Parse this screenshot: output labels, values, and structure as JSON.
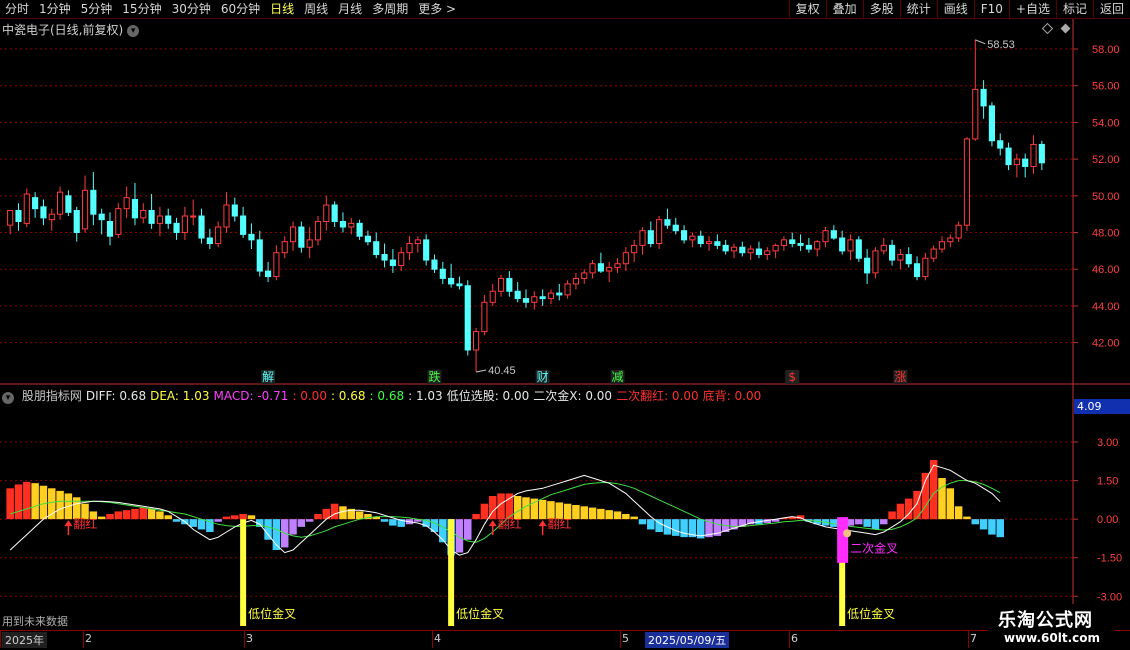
{
  "toolbar": {
    "periods": [
      "分时",
      "1分钟",
      "5分钟",
      "15分钟",
      "30分钟",
      "60分钟",
      "日线",
      "周线",
      "月线",
      "多周期",
      "更多 >"
    ],
    "active_period": "日线",
    "actions": [
      "复权",
      "叠加",
      "多股",
      "统计",
      "画线",
      "F10",
      "+自选",
      "标记",
      "返回"
    ]
  },
  "stock": {
    "title": "中瓷电子(日线,前复权)",
    "chevron": "chevron-down-icon"
  },
  "indicator_header": [
    {
      "text": "股朋指标网",
      "color": "#c8c8c8"
    },
    {
      "text": "DIFF: 0.68",
      "color": "#e8e8e8"
    },
    {
      "text": "DEA: 1.03",
      "color": "#ffff40"
    },
    {
      "text": "MACD: -0.71",
      "color": "#ff40ff"
    },
    {
      "text": ": 0.00",
      "color": "#ff3030"
    },
    {
      "text": ": 0.68",
      "color": "#ffff40"
    },
    {
      "text": ": 0.68",
      "color": "#40ff40"
    },
    {
      "text": ": 1.03",
      "color": "#e8e8e8"
    },
    {
      "text": "低位选股: 0.00",
      "color": "#e8e8e8"
    },
    {
      "text": "二次金X: 0.00",
      "color": "#e8e8e8"
    },
    {
      "text": "二次翻红: 0.00",
      "color": "#ff3030"
    },
    {
      "text": "底背: 0.00",
      "color": "#ff3030"
    }
  ],
  "right_readout": "4.09",
  "future_note": "用到未来数据",
  "dates": [
    "2025年",
    "2",
    "3",
    "4",
    "5",
    "6",
    "7"
  ],
  "selected_date": "2025/05/09/五",
  "watermark": {
    "name": "乐淘公式网",
    "url": "www.60lt.com"
  },
  "colors": {
    "up": "#ff3c3c",
    "down": "#54ffff",
    "grid": "#8b0000",
    "axis": "#c03030",
    "yellow": "#ffff40",
    "magenta": "#ff2dff"
  },
  "chart_data": [
    {
      "type": "candlestick",
      "title": "中瓷电子(日线,前复权)",
      "y_ticks": [
        42.0,
        44.0,
        46.0,
        48.0,
        50.0,
        52.0,
        54.0,
        56.0,
        58.0
      ],
      "ylim": [
        40.4,
        58.6
      ],
      "max_label": "58.53",
      "min_label": "40.45",
      "ohlc": [
        [
          48.4,
          48.9,
          47.9,
          49.2
        ],
        [
          49.2,
          49.6,
          48.1,
          48.6
        ],
        [
          48.5,
          50.4,
          48.3,
          50.1
        ],
        [
          49.9,
          50.2,
          48.8,
          49.3
        ],
        [
          49.4,
          49.8,
          48.4,
          48.8
        ],
        [
          48.7,
          49.3,
          48.1,
          49.0
        ],
        [
          49.0,
          50.5,
          48.7,
          50.2
        ],
        [
          50.0,
          50.3,
          48.9,
          49.1
        ],
        [
          49.2,
          49.4,
          47.5,
          48.0
        ],
        [
          48.2,
          51.1,
          48.0,
          50.3
        ],
        [
          50.3,
          51.3,
          48.4,
          49.0
        ],
        [
          49.0,
          49.3,
          47.9,
          48.7
        ],
        [
          48.6,
          49.1,
          47.3,
          47.8
        ],
        [
          47.9,
          49.6,
          47.7,
          49.3
        ],
        [
          49.3,
          50.5,
          48.8,
          49.9
        ],
        [
          49.8,
          50.7,
          48.4,
          48.8
        ],
        [
          48.8,
          49.6,
          48.5,
          49.2
        ],
        [
          49.2,
          50.1,
          48.2,
          48.5
        ],
        [
          48.5,
          49.4,
          47.8,
          48.9
        ],
        [
          48.9,
          49.3,
          48.2,
          48.5
        ],
        [
          48.5,
          48.8,
          47.6,
          48.0
        ],
        [
          48.0,
          49.4,
          47.6,
          48.9
        ],
        [
          48.9,
          49.8,
          48.4,
          48.9
        ],
        [
          48.9,
          49.3,
          47.4,
          47.7
        ],
        [
          47.7,
          48.2,
          47.1,
          47.4
        ],
        [
          47.4,
          48.6,
          47.2,
          48.3
        ],
        [
          48.3,
          50.2,
          48.0,
          49.5
        ],
        [
          49.5,
          49.9,
          48.6,
          48.9
        ],
        [
          48.9,
          49.4,
          47.7,
          47.9
        ],
        [
          47.9,
          48.5,
          47.1,
          47.6
        ],
        [
          47.6,
          48.1,
          45.6,
          45.9
        ],
        [
          45.9,
          46.4,
          45.3,
          45.6
        ],
        [
          45.6,
          47.3,
          45.4,
          46.9
        ],
        [
          46.9,
          47.8,
          46.6,
          47.5
        ],
        [
          47.5,
          48.6,
          47.0,
          48.3
        ],
        [
          48.3,
          48.6,
          46.9,
          47.2
        ],
        [
          47.2,
          48.3,
          46.6,
          47.6
        ],
        [
          47.6,
          48.9,
          47.3,
          48.6
        ],
        [
          48.6,
          50.0,
          48.1,
          49.5
        ],
        [
          49.5,
          49.7,
          48.3,
          48.6
        ],
        [
          48.6,
          49.1,
          48.0,
          48.3
        ],
        [
          48.3,
          48.8,
          47.9,
          48.5
        ],
        [
          48.5,
          48.7,
          47.6,
          47.8
        ],
        [
          47.8,
          48.1,
          47.3,
          47.5
        ],
        [
          47.5,
          48.0,
          46.6,
          46.8
        ],
        [
          46.8,
          47.4,
          46.1,
          46.5
        ],
        [
          46.5,
          47.1,
          45.8,
          46.2
        ],
        [
          46.2,
          47.2,
          45.9,
          46.9
        ],
        [
          46.9,
          47.8,
          46.5,
          47.4
        ],
        [
          47.4,
          47.8,
          46.9,
          47.6
        ],
        [
          47.6,
          47.9,
          46.2,
          46.5
        ],
        [
          46.5,
          46.8,
          45.8,
          46.0
        ],
        [
          46.0,
          46.4,
          45.2,
          45.5
        ],
        [
          45.5,
          46.3,
          45.0,
          45.2
        ],
        [
          45.2,
          45.6,
          44.9,
          45.1
        ],
        [
          45.1,
          45.4,
          41.3,
          41.6
        ],
        [
          41.6,
          42.8,
          40.4,
          42.6
        ],
        [
          42.6,
          44.6,
          42.4,
          44.2
        ],
        [
          44.2,
          45.2,
          44.0,
          44.8
        ],
        [
          44.8,
          45.7,
          44.5,
          45.5
        ],
        [
          45.5,
          45.9,
          44.5,
          44.8
        ],
        [
          44.8,
          45.3,
          44.2,
          44.4
        ],
        [
          44.4,
          44.9,
          43.9,
          44.2
        ],
        [
          44.2,
          44.8,
          43.8,
          44.5
        ],
        [
          44.5,
          44.9,
          44.0,
          44.4
        ],
        [
          44.4,
          44.9,
          44.1,
          44.7
        ],
        [
          44.7,
          45.2,
          44.3,
          44.6
        ],
        [
          44.6,
          45.4,
          44.4,
          45.2
        ],
        [
          45.2,
          45.8,
          44.9,
          45.5
        ],
        [
          45.5,
          46.0,
          45.2,
          45.8
        ],
        [
          45.8,
          46.5,
          45.5,
          46.3
        ],
        [
          46.3,
          46.9,
          45.8,
          45.9
        ],
        [
          45.9,
          46.4,
          45.3,
          46.1
        ],
        [
          46.1,
          46.6,
          45.8,
          46.3
        ],
        [
          46.3,
          47.2,
          45.9,
          46.9
        ],
        [
          46.9,
          47.6,
          46.4,
          47.3
        ],
        [
          47.3,
          48.3,
          46.8,
          48.1
        ],
        [
          48.1,
          48.6,
          47.2,
          47.4
        ],
        [
          47.4,
          48.9,
          47.1,
          48.7
        ],
        [
          48.7,
          49.3,
          48.2,
          48.4
        ],
        [
          48.4,
          48.8,
          47.9,
          48.1
        ],
        [
          48.1,
          48.4,
          47.4,
          47.6
        ],
        [
          47.6,
          48.0,
          47.2,
          47.8
        ],
        [
          47.8,
          48.1,
          47.2,
          47.4
        ],
        [
          47.4,
          47.8,
          47.0,
          47.5
        ],
        [
          47.5,
          47.9,
          47.1,
          47.3
        ],
        [
          47.3,
          47.6,
          46.8,
          47.0
        ],
        [
          47.0,
          47.4,
          46.6,
          47.2
        ],
        [
          47.2,
          47.5,
          46.7,
          46.9
        ],
        [
          46.9,
          47.3,
          46.5,
          47.1
        ],
        [
          47.1,
          47.5,
          46.6,
          46.8
        ],
        [
          46.8,
          47.2,
          46.5,
          47.0
        ],
        [
          47.0,
          47.4,
          46.6,
          47.3
        ],
        [
          47.3,
          47.8,
          47.0,
          47.6
        ],
        [
          47.6,
          48.0,
          47.2,
          47.4
        ],
        [
          47.4,
          47.9,
          47.0,
          47.3
        ],
        [
          47.3,
          47.7,
          46.9,
          47.1
        ],
        [
          47.1,
          47.6,
          46.7,
          47.5
        ],
        [
          47.5,
          48.3,
          47.2,
          48.1
        ],
        [
          48.1,
          48.4,
          47.6,
          47.7
        ],
        [
          47.7,
          48.1,
          46.8,
          47.0
        ],
        [
          47.0,
          47.9,
          46.5,
          47.6
        ],
        [
          47.6,
          47.8,
          46.4,
          46.6
        ],
        [
          46.6,
          47.1,
          45.2,
          45.8
        ],
        [
          45.8,
          47.2,
          45.5,
          47.0
        ],
        [
          47.0,
          47.7,
          46.8,
          47.3
        ],
        [
          47.3,
          47.6,
          46.2,
          46.5
        ],
        [
          46.5,
          47.1,
          46.0,
          46.8
        ],
        [
          46.8,
          47.2,
          46.1,
          46.3
        ],
        [
          46.3,
          46.7,
          45.4,
          45.6
        ],
        [
          45.6,
          46.9,
          45.4,
          46.6
        ],
        [
          46.6,
          47.3,
          46.4,
          47.1
        ],
        [
          47.1,
          47.8,
          46.9,
          47.5
        ],
        [
          47.5,
          47.9,
          47.2,
          47.7
        ],
        [
          47.7,
          48.6,
          47.5,
          48.4
        ],
        [
          48.4,
          53.2,
          48.1,
          53.1
        ],
        [
          53.1,
          58.5,
          53.0,
          55.8
        ],
        [
          55.8,
          56.3,
          54.2,
          54.9
        ],
        [
          54.9,
          55.1,
          52.7,
          53.0
        ],
        [
          53.0,
          53.4,
          52.2,
          52.6
        ],
        [
          52.6,
          52.9,
          51.4,
          51.7
        ],
        [
          51.7,
          52.3,
          51.0,
          52.0
        ],
        [
          52.0,
          52.3,
          51.0,
          51.6
        ],
        [
          51.6,
          53.3,
          51.2,
          52.8
        ],
        [
          52.8,
          53.0,
          51.4,
          51.8
        ]
      ],
      "signal_labels": [
        {
          "text": "解",
          "color": "#54ffff",
          "index": 31
        },
        {
          "text": "跌",
          "color": "#40ff40",
          "index": 51
        },
        {
          "text": "财",
          "color": "#54ffff",
          "index": 64
        },
        {
          "text": "减",
          "color": "#40ff40",
          "index": 73
        },
        {
          "text": "$",
          "color": "#ff3030",
          "index": 94
        },
        {
          "text": "涨",
          "color": "#ff3030",
          "index": 107
        }
      ]
    },
    {
      "type": "bar",
      "title": "股朋指标网",
      "y_ticks": [
        3.0,
        1.5,
        0.0,
        -1.5,
        -3.0
      ],
      "ylim": [
        -3.3,
        4.09
      ],
      "macd": [
        1.2,
        1.35,
        1.45,
        1.4,
        1.3,
        1.2,
        1.1,
        1.0,
        0.85,
        0.6,
        0.3,
        0.1,
        0.2,
        0.3,
        0.35,
        0.4,
        0.45,
        0.4,
        0.3,
        0.15,
        -0.1,
        -0.2,
        -0.3,
        -0.4,
        -0.5,
        -0.1,
        0.1,
        0.15,
        0.2,
        0.15,
        -0.3,
        -0.8,
        -1.2,
        -1.1,
        -0.6,
        -0.3,
        -0.1,
        0.2,
        0.4,
        0.6,
        0.5,
        0.4,
        0.3,
        0.2,
        0.1,
        -0.1,
        -0.25,
        -0.3,
        -0.2,
        -0.1,
        -0.3,
        -0.5,
        -0.9,
        -1.4,
        -1.3,
        -0.8,
        0.2,
        0.6,
        0.9,
        1.0,
        1.0,
        0.9,
        0.85,
        0.8,
        0.75,
        0.7,
        0.65,
        0.6,
        0.55,
        0.5,
        0.45,
        0.4,
        0.35,
        0.3,
        0.2,
        0.1,
        -0.2,
        -0.4,
        -0.5,
        -0.6,
        -0.65,
        -0.7,
        -0.7,
        -0.75,
        -0.7,
        -0.65,
        -0.5,
        -0.4,
        -0.3,
        -0.2,
        -0.2,
        -0.15,
        -0.1,
        0.05,
        0.1,
        0.15,
        -0.1,
        -0.2,
        -0.25,
        -0.3,
        -0.3,
        -0.25,
        -0.2,
        -0.3,
        -0.4,
        -0.2,
        0.3,
        0.6,
        0.8,
        1.1,
        1.8,
        2.3,
        1.6,
        1.2,
        0.5,
        0.1,
        -0.2,
        -0.4,
        -0.6,
        -0.7
      ],
      "diff": [
        -1.2,
        -0.9,
        -0.6,
        -0.3,
        0.0,
        0.2,
        0.4,
        0.5,
        0.6,
        0.65,
        0.7,
        0.7,
        0.68,
        0.65,
        0.6,
        0.55,
        0.5,
        0.45,
        0.4,
        0.3,
        0.1,
        -0.1,
        -0.4,
        -0.6,
        -0.8,
        -0.7,
        -0.5,
        -0.3,
        -0.15,
        -0.05,
        -0.2,
        -0.6,
        -1.0,
        -1.3,
        -1.2,
        -0.9,
        -0.6,
        -0.3,
        0.0,
        0.2,
        0.3,
        0.35,
        0.35,
        0.3,
        0.25,
        0.15,
        0.05,
        -0.05,
        -0.1,
        -0.15,
        -0.25,
        -0.5,
        -0.8,
        -1.2,
        -1.4,
        -1.3,
        -0.8,
        -0.2,
        0.3,
        0.6,
        0.8,
        1.0,
        1.1,
        1.15,
        1.2,
        1.3,
        1.4,
        1.5,
        1.6,
        1.7,
        1.6,
        1.5,
        1.4,
        1.2,
        1.0,
        0.7,
        0.4,
        0.1,
        -0.15,
        -0.3,
        -0.45,
        -0.55,
        -0.6,
        -0.65,
        -0.6,
        -0.55,
        -0.45,
        -0.35,
        -0.25,
        -0.15,
        -0.1,
        -0.05,
        0.0,
        0.05,
        0.1,
        0.05,
        -0.1,
        -0.2,
        -0.3,
        -0.35,
        -0.4,
        -0.45,
        -0.5,
        -0.55,
        -0.6,
        -0.5,
        -0.3,
        -0.1,
        0.2,
        0.6,
        1.5,
        2.1,
        2.0,
        1.9,
        1.7,
        1.5,
        1.4,
        1.2,
        1.0,
        0.68
      ],
      "dea": [
        0.2,
        0.3,
        0.4,
        0.5,
        0.6,
        0.65,
        0.7,
        0.7,
        0.7,
        0.7,
        0.7,
        0.68,
        0.65,
        0.6,
        0.55,
        0.5,
        0.45,
        0.4,
        0.35,
        0.3,
        0.25,
        0.2,
        0.1,
        0.0,
        -0.1,
        -0.2,
        -0.25,
        -0.28,
        -0.28,
        -0.25,
        -0.25,
        -0.3,
        -0.4,
        -0.55,
        -0.65,
        -0.7,
        -0.65,
        -0.55,
        -0.45,
        -0.3,
        -0.2,
        -0.1,
        0.0,
        0.05,
        0.1,
        0.1,
        0.1,
        0.08,
        0.05,
        0.0,
        -0.05,
        -0.15,
        -0.3,
        -0.5,
        -0.7,
        -0.85,
        -0.9,
        -0.75,
        -0.5,
        -0.2,
        0.1,
        0.3,
        0.5,
        0.65,
        0.8,
        0.95,
        1.05,
        1.15,
        1.25,
        1.35,
        1.4,
        1.42,
        1.42,
        1.38,
        1.3,
        1.2,
        1.05,
        0.9,
        0.75,
        0.6,
        0.45,
        0.3,
        0.15,
        0.0,
        -0.1,
        -0.2,
        -0.25,
        -0.28,
        -0.28,
        -0.25,
        -0.22,
        -0.18,
        -0.15,
        -0.1,
        -0.08,
        -0.05,
        -0.05,
        -0.08,
        -0.12,
        -0.18,
        -0.22,
        -0.28,
        -0.32,
        -0.36,
        -0.4,
        -0.42,
        -0.4,
        -0.3,
        -0.15,
        0.05,
        0.5,
        1.0,
        1.25,
        1.4,
        1.5,
        1.5,
        1.45,
        1.35,
        1.2,
        1.03
      ],
      "markers": [
        {
          "type": "翻红",
          "index": 7
        },
        {
          "type": "翻红",
          "index": 58
        },
        {
          "type": "翻红",
          "index": 64
        },
        {
          "type": "低位金叉",
          "index": 28
        },
        {
          "type": "低位金叉",
          "index": 53
        },
        {
          "type": "低位金叉",
          "index": 100
        },
        {
          "type": "二次金叉",
          "index": 101
        }
      ]
    }
  ]
}
